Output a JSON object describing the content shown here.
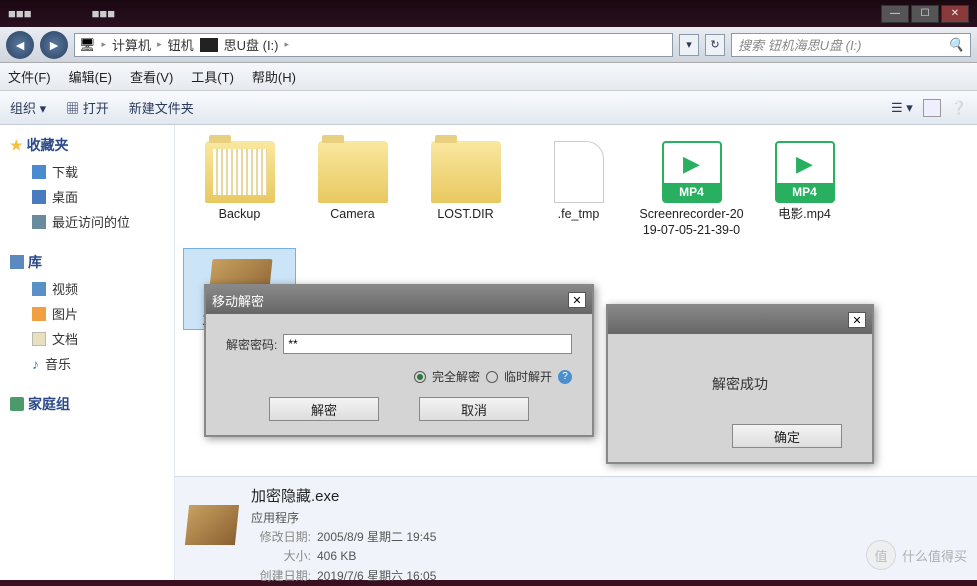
{
  "titlebar": {
    "app1": "■■■",
    "app2": "■■■"
  },
  "address": {
    "seg1": "计算机",
    "seg2": "钮机",
    "seg3": "思U盘 (I:)",
    "searchPlaceholder": "搜索 钮机海思U盘 (I:)"
  },
  "menu": {
    "file": "文件(F)",
    "edit": "编辑(E)",
    "view": "查看(V)",
    "tools": "工具(T)",
    "help": "帮助(H)"
  },
  "toolbar": {
    "organize": "组织",
    "open": "打开",
    "newfolder": "新建文件夹"
  },
  "sidebar": {
    "fav": "收藏夹",
    "down": "下载",
    "desk": "桌面",
    "recent": "最近访问的位",
    "lib": "库",
    "vid": "视频",
    "pic": "图片",
    "doc": "文档",
    "mus": "音乐",
    "home": "家庭组"
  },
  "files": [
    {
      "label": "Backup",
      "type": "folder-open"
    },
    {
      "label": "Camera",
      "type": "folder"
    },
    {
      "label": "LOST.DIR",
      "type": "folder"
    },
    {
      "label": ".fe_tmp",
      "type": "file"
    },
    {
      "label": "Screenrecorder-2019-07-05-21-39-0",
      "type": "mp4"
    },
    {
      "label": "电影.mp4",
      "type": "mp4"
    },
    {
      "label": "加密隐藏.exe",
      "type": "exe",
      "selected": true
    }
  ],
  "detail": {
    "name": "加密隐藏.exe",
    "type": "应用程序",
    "mdateLabel": "修改日期:",
    "mdate": "2005/8/9 星期二 19:45",
    "sizeLabel": "大小:",
    "size": "406 KB",
    "cdateLabel": "创建日期:",
    "cdate": "2019/7/6 星期六 16:05"
  },
  "dlg1": {
    "title": "移动解密",
    "pwdLabel": "解密密码:",
    "pwdValue": "**",
    "opt1": "完全解密",
    "opt2": "临时解开",
    "btnDecrypt": "解密",
    "btnCancel": "取消"
  },
  "dlg2": {
    "msg": "解密成功",
    "ok": "确定"
  },
  "watermark": {
    "icon": "值",
    "text": "什么值得买"
  }
}
